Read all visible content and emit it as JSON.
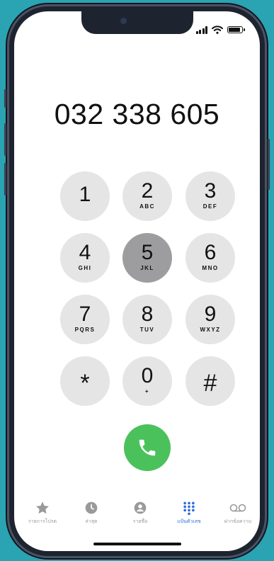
{
  "status": {
    "signal_icon": "signal-bars-icon",
    "wifi_icon": "wifi-icon",
    "battery_icon": "battery-icon"
  },
  "dialer": {
    "entered_number": "032 338 605",
    "keys": [
      {
        "digit": "1",
        "letters": ""
      },
      {
        "digit": "2",
        "letters": "ABC"
      },
      {
        "digit": "3",
        "letters": "DEF"
      },
      {
        "digit": "4",
        "letters": "GHI"
      },
      {
        "digit": "5",
        "letters": "JKL"
      },
      {
        "digit": "6",
        "letters": "MNO"
      },
      {
        "digit": "7",
        "letters": "PQRS"
      },
      {
        "digit": "8",
        "letters": "TUV"
      },
      {
        "digit": "9",
        "letters": "WXYZ"
      },
      {
        "digit": "*",
        "letters": ""
      },
      {
        "digit": "0",
        "letters": "+"
      },
      {
        "digit": "#",
        "letters": ""
      }
    ],
    "pressed_key": "5",
    "call_icon": "phone-icon"
  },
  "tabs": [
    {
      "label": "รายการโปรด",
      "icon": "star-icon",
      "active": false
    },
    {
      "label": "ล่าสุด",
      "icon": "clock-icon",
      "active": false
    },
    {
      "label": "รายชื่อ",
      "icon": "contact-icon",
      "active": false
    },
    {
      "label": "แป้นตัวเลข",
      "icon": "keypad-icon",
      "active": true
    },
    {
      "label": "ฝากข้อความ",
      "icon": "voicemail-icon",
      "active": false
    }
  ],
  "colors": {
    "accent": "#2f6ddb",
    "call": "#4bc15c",
    "key": "#e5e5e6",
    "key_pressed": "#9d9d9f",
    "background": "#2aa3b3"
  }
}
